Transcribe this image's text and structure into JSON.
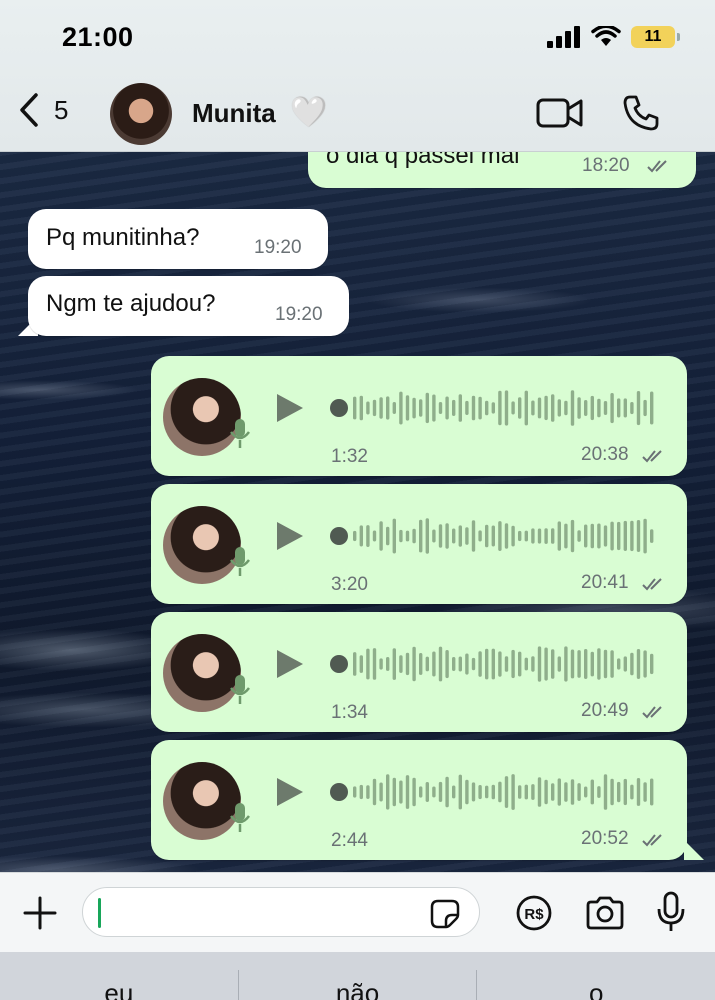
{
  "status_bar": {
    "time": "21:00",
    "battery": "11"
  },
  "header": {
    "back_count": "5",
    "contact_name": "Munita",
    "contact_emoji": "🤍"
  },
  "messages": {
    "top": {
      "text": "o dia q passei mal",
      "time": "18:20"
    },
    "in1": {
      "text": "Pq munitinha?",
      "time": "19:20"
    },
    "in2": {
      "text": "Ngm te ajudou?",
      "time": "19:20"
    }
  },
  "voice_notes": [
    {
      "duration": "1:32",
      "time": "20:38"
    },
    {
      "duration": "3:20",
      "time": "20:41"
    },
    {
      "duration": "1:34",
      "time": "20:49"
    },
    {
      "duration": "2:44",
      "time": "20:52"
    }
  ],
  "input": {
    "placeholder": "",
    "value": ""
  },
  "pay_label": "R$",
  "suggestions": [
    "eu",
    "não",
    "o"
  ],
  "colors": {
    "outgoing": "#d9fdd3",
    "incoming": "#ffffff",
    "accent": "#18a65a"
  }
}
